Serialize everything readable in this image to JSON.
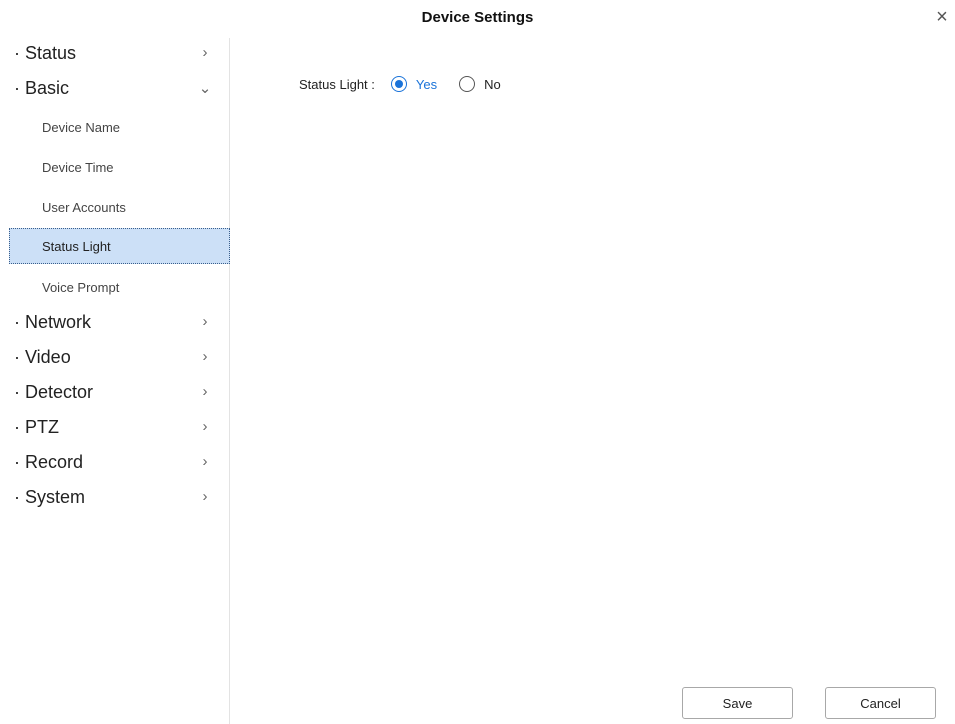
{
  "window": {
    "title": "Device Settings",
    "close_glyph": "×"
  },
  "sidebar": {
    "categories_top": [
      {
        "label": "· Status",
        "chevron": "›",
        "expanded": false
      },
      {
        "label": "· Basic",
        "chevron": "⌄",
        "expanded": true
      }
    ],
    "basic_items": [
      {
        "label": "Device Name"
      },
      {
        "label": "Device Time"
      },
      {
        "label": "User Accounts"
      },
      {
        "label": "Status Light",
        "selected": true
      },
      {
        "label": "Voice Prompt"
      }
    ],
    "categories_bottom": [
      {
        "label": "· Network",
        "chevron": "›"
      },
      {
        "label": "· Video",
        "chevron": "›"
      },
      {
        "label": "· Detector",
        "chevron": "›"
      },
      {
        "label": "· PTZ",
        "chevron": "›"
      },
      {
        "label": "· Record",
        "chevron": "›"
      },
      {
        "label": "· System",
        "chevron": "›"
      }
    ]
  },
  "content": {
    "status_light": {
      "label": "Status Light :",
      "options": [
        {
          "label": "Yes",
          "checked": true
        },
        {
          "label": "No",
          "checked": false
        }
      ]
    }
  },
  "buttons": {
    "save": "Save",
    "cancel": "Cancel"
  },
  "colors": {
    "accent": "#1a73d9",
    "selected_bg": "#cce0f7"
  }
}
